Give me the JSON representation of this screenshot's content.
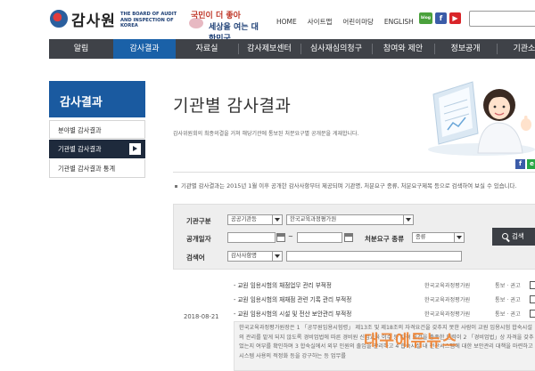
{
  "header": {
    "logo_text": "감사원",
    "logo_sub": "THE BOARD OF AUDIT AND INSPECTION OF KOREA",
    "slogan_line1": "국민이 더 좋아",
    "slogan_line2": "세상을 여는 대한민국",
    "top_links": [
      "HOME",
      "사이트맵",
      "어린이마당",
      "ENGLISH"
    ],
    "sns": {
      "blog": "blog",
      "facebook": "f",
      "youtube": "▶"
    }
  },
  "nav": {
    "items": [
      "알림",
      "감사결과",
      "자료실",
      "감사제보센터",
      "심사재심의청구",
      "참여와 제안",
      "정보공개",
      "기관소개"
    ],
    "active_index": 1
  },
  "sidebar": {
    "title": "감사결과",
    "items": [
      "분야별 감사결과",
      "기관별 감사결과",
      "기관별 감사결과 통계"
    ],
    "active_index": 1
  },
  "content": {
    "title": "기관별 감사결과",
    "description": "감사위원회의 최종의결을 거쳐 해당기관에 통보된 처분요구별 공개문을 게재합니다.",
    "share": {
      "facebook": "f",
      "other": "e"
    },
    "notice": "기관별 감사결과는 2015년 1월 이후 공개한 감사사항부터 제공되며 기관명, 처분요구 종류, 처분요구제목 등으로 검색하여 보실 수 있습니다."
  },
  "search": {
    "org_label": "기관구분",
    "org_type_value": "공공기관등",
    "org_name_value": "한국교육과정평가원",
    "period_label": "공개일자",
    "date_from": "",
    "date_to": "",
    "tilde": "~",
    "req_type_label": "처분요구 종류",
    "req_type_value": "종류",
    "keyword_label": "검색어",
    "keyword_field_value": "감사사항명",
    "keyword_input": "",
    "button_label": "검색"
  },
  "results": {
    "date": "2018-08-21",
    "items": [
      {
        "title": "- 교원 임용시험의 채점업무 관리 부적정",
        "org": "한국교육과정평가원",
        "type": "통보 · 권고"
      },
      {
        "title": "- 교원 임용시험의 재채점 관련 기록 관리 부적정",
        "org": "한국교육과정평가원",
        "type": "통보 · 권고"
      },
      {
        "title": "- 교원 임용시험의 시설 및 전산 보안관리 부적정",
        "org": "한국교육과정평가원",
        "type": "통보 · 권고"
      }
    ],
    "summary": "한국교육과정평가원장은 1 「공무원임용시험령」 제13조 및 제18조의 자격요건을 갖추지 못한 사람이 교원 임용시험 합숙시설의 관리를 맡게 되지 않도록 경비업법에 따른 경비원 신임교육 이수 등 자격 요건을 충족한 인력이 2 「경비업법」상 자격을 갖추었는지 여부를 확인하며 3 합숙실에서 외부 인원의 출입을 관리하고 4 합숙시설 내 전산시스템에 대한 보안관리 대책을 마련하고 시스템 사용의 적정화 등을 강구하는 등 업무를",
    "watermark": "대구에듀뉴스"
  }
}
